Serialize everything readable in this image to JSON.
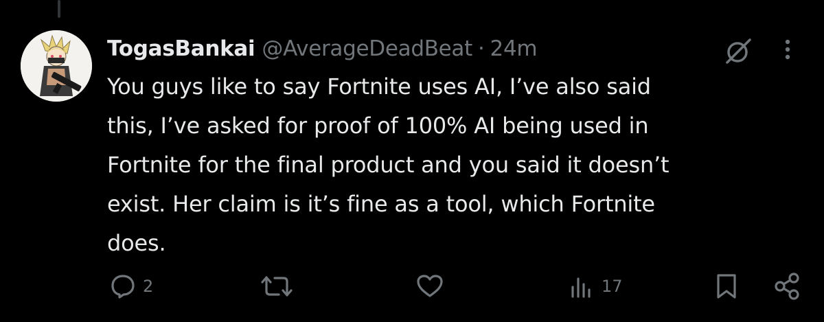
{
  "tweet": {
    "display_name": "TogasBankai",
    "handle": "@AverageDeadBeat",
    "separator": "·",
    "time": "24m",
    "text": "You guys like to say Fortnite uses AI, I’ve also said this, I’ve asked for proof of 100% AI being used in Fortnite for the final product and you said it doesn’t exist. Her claim is it’s fine as a tool, which Fortnite does.",
    "text_lines": [
      "You guys like to say Fortnite uses AI, I’ve also said",
      "this, I’ve asked for proof of 100% AI being used in",
      "Fortnite for the final product and you said it doesn’t",
      "exist. Her claim is it’s fine as a tool, which Fortnite",
      "does."
    ]
  },
  "actions": {
    "reply": {
      "icon": "reply-icon",
      "count": "2"
    },
    "repost": {
      "icon": "repost-icon",
      "count": ""
    },
    "like": {
      "icon": "heart-icon",
      "count": ""
    },
    "views": {
      "icon": "views-icon",
      "count": "17"
    },
    "bookmark": {
      "icon": "bookmark-icon"
    },
    "share": {
      "icon": "share-icon"
    }
  },
  "header_icons": {
    "grok": "grok-icon",
    "more": "more-icon"
  },
  "colors": {
    "background": "#000000",
    "text_primary": "#e7e9ea",
    "text_secondary": "#71767b",
    "icon": "#71767b",
    "thread_line": "#333639"
  }
}
